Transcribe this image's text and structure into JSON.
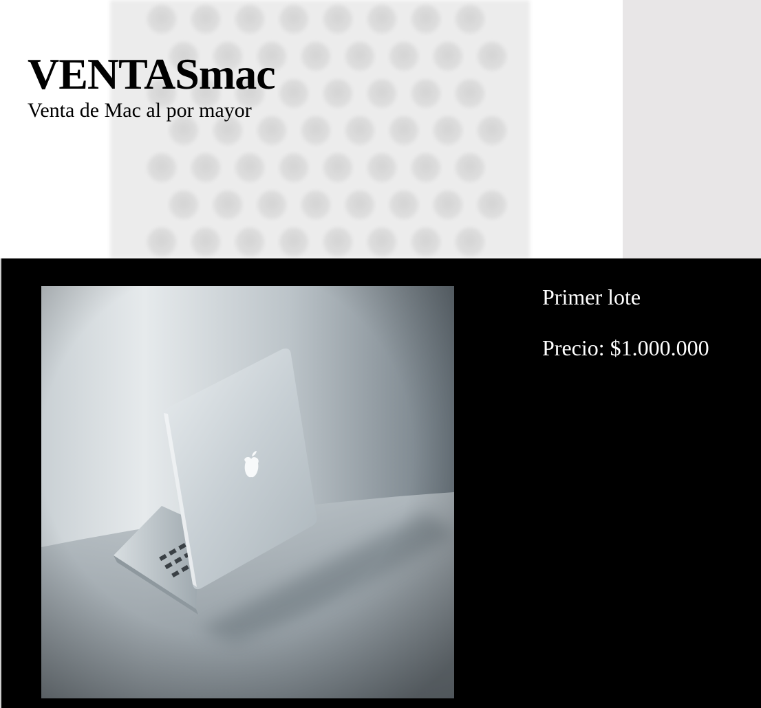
{
  "site": {
    "title": "VENTASmac",
    "subtitle": "Venta de Mac al por mayor"
  },
  "product": {
    "name": "Primer lote",
    "price_label": "Precio: $1.000.000",
    "image_description_icon": "laptop-photo"
  },
  "colors": {
    "hero_background": "#ffffff",
    "hero_right_panel": "#e8e6e7",
    "product_section_background": "#000000",
    "product_text": "#ffffff"
  }
}
